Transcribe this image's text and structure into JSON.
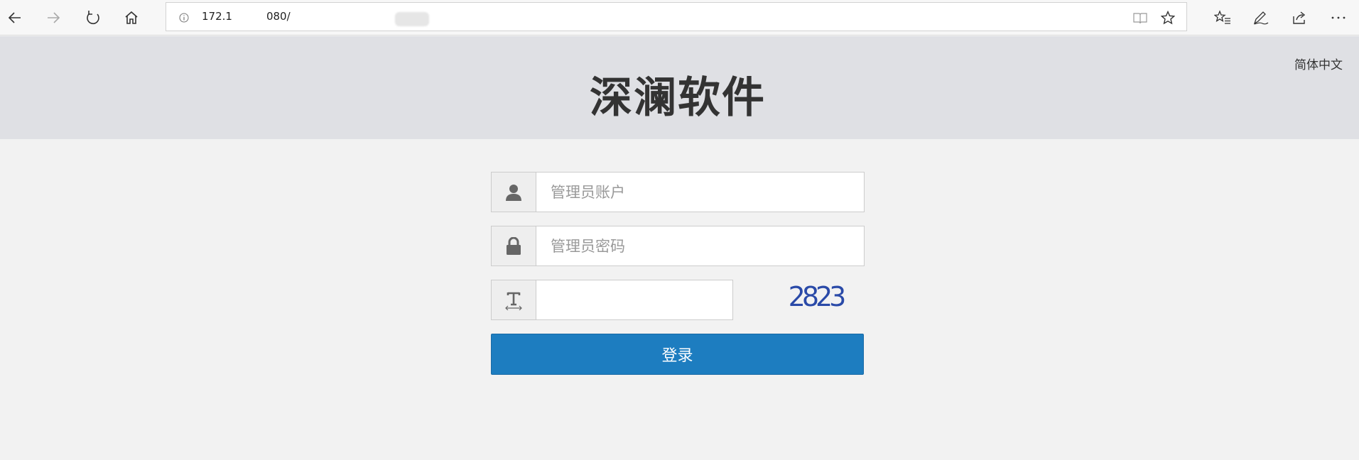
{
  "browser": {
    "address": "172.1",
    "address_tail": "080/",
    "icons": [
      "back-icon",
      "forward-icon",
      "refresh-icon",
      "home-icon",
      "info-icon",
      "reading-view-icon",
      "favorite-star-icon",
      "favorites-list-icon",
      "pen-icon",
      "share-icon",
      "more-icon"
    ]
  },
  "header": {
    "brand": "深澜软件",
    "language": "简体中文",
    "background": "#dfe0e4"
  },
  "login": {
    "username_placeholder": "管理员账户",
    "username_value": "",
    "password_placeholder": "管理员密码",
    "password_value": "",
    "captcha_value": "",
    "captcha_text": "2823",
    "submit_label": "登录",
    "submit_color": "#1d7dc0",
    "icons": [
      "user-icon",
      "lock-icon",
      "text-icon"
    ]
  }
}
